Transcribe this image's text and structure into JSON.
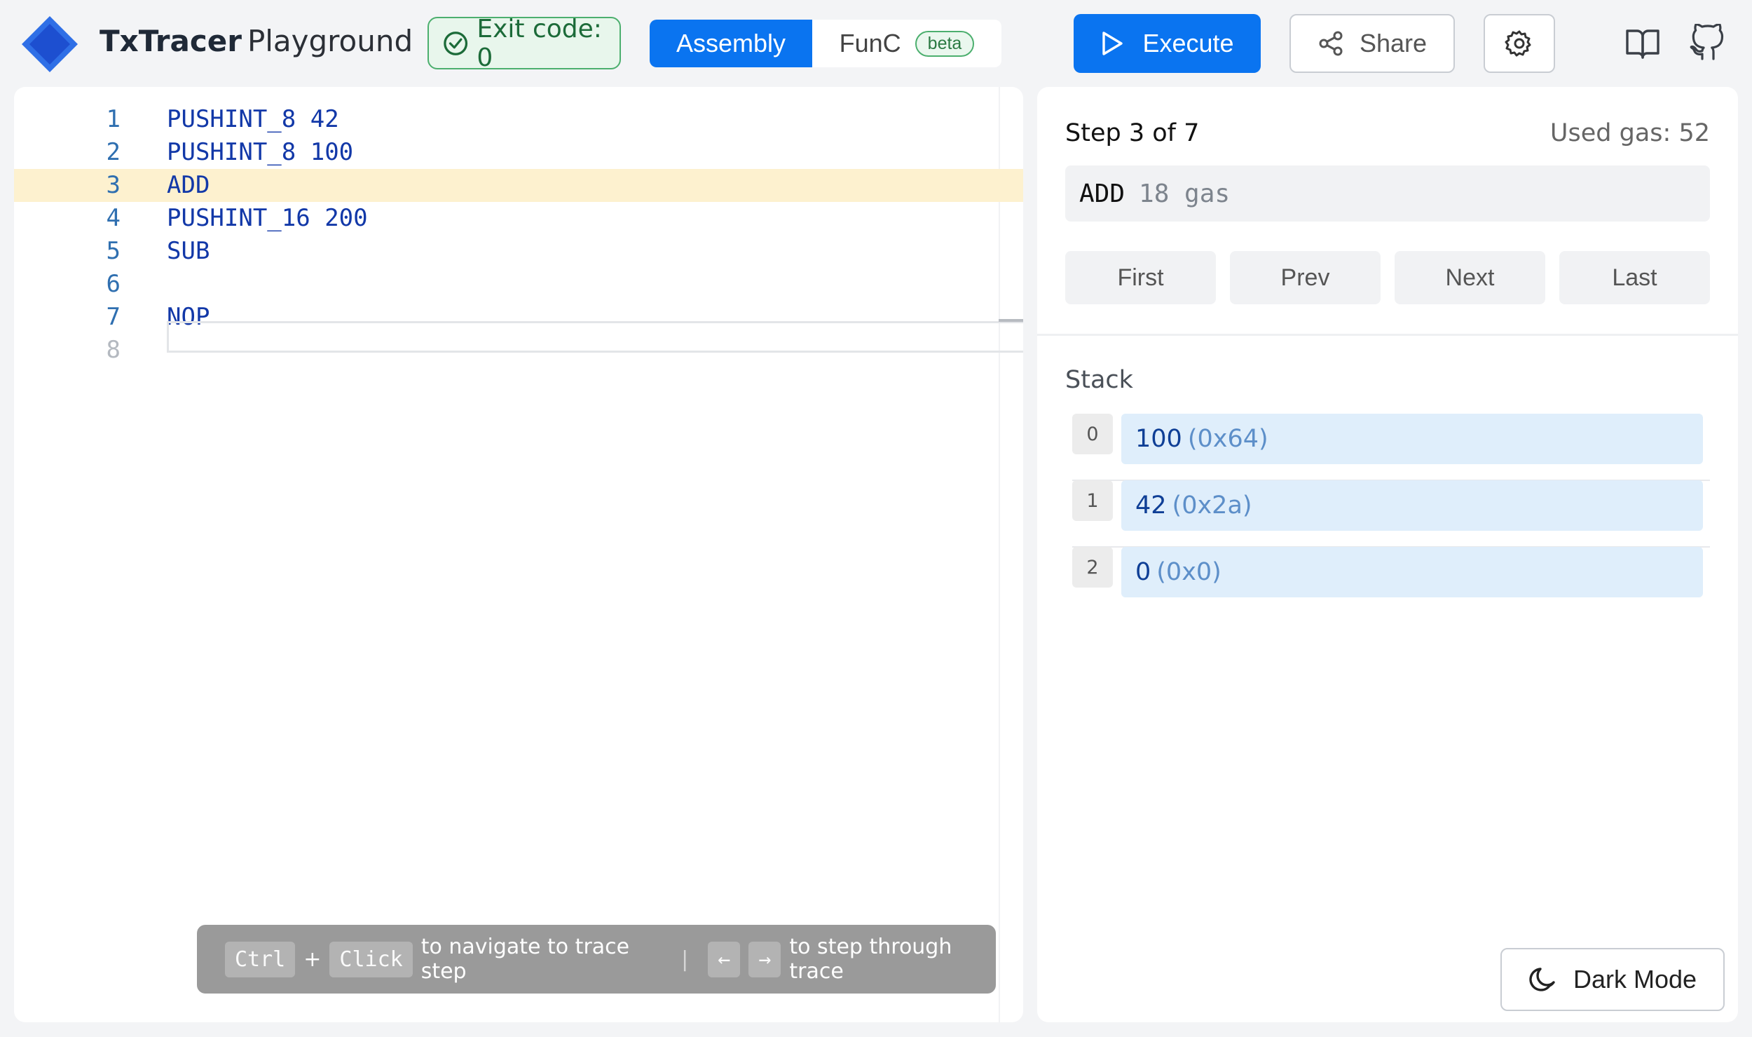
{
  "header": {
    "brand_bold": "TxTracer",
    "brand_light": "Playground",
    "exit_badge": "Exit code: 0",
    "modes": {
      "assembly": "Assembly",
      "func": "FunC",
      "beta": "beta"
    },
    "execute_label": "Execute",
    "share_label": "Share",
    "icons": [
      "logo-icon",
      "check-circle-icon",
      "play-icon",
      "share-icon",
      "gear-icon",
      "book-icon",
      "github-icon"
    ]
  },
  "editor": {
    "active_line": 3,
    "lines": [
      {
        "no": "1",
        "op": "PUSHINT_8",
        "arg": "42"
      },
      {
        "no": "2",
        "op": "PUSHINT_8",
        "arg": "100"
      },
      {
        "no": "3",
        "op": "ADD",
        "arg": ""
      },
      {
        "no": "4",
        "op": "PUSHINT_16",
        "arg": "200"
      },
      {
        "no": "5",
        "op": "SUB",
        "arg": ""
      },
      {
        "no": "6",
        "op": "",
        "arg": ""
      },
      {
        "no": "7",
        "op": "NOP",
        "arg": ""
      },
      {
        "no": "8",
        "op": "",
        "arg": ""
      }
    ],
    "hint": {
      "key_ctrl": "Ctrl",
      "plus": "+",
      "key_click": "Click",
      "text1": "to navigate to trace step",
      "sep": "|",
      "key_left": "←",
      "key_right": "→",
      "text2": "to step through trace"
    }
  },
  "panel": {
    "step_title": "Step 3 of 7",
    "used_gas": "Used gas: 52",
    "instruction": {
      "op": "ADD",
      "gas": "18 gas"
    },
    "nav": {
      "first": "First",
      "prev": "Prev",
      "next": "Next",
      "last": "Last"
    },
    "stack_label": "Stack",
    "stack": [
      {
        "index": "0",
        "dec": "100",
        "hex": "(0x64)"
      },
      {
        "index": "1",
        "dec": "42",
        "hex": "(0x2a)"
      },
      {
        "index": "2",
        "dec": "0",
        "hex": "(0x0)"
      }
    ],
    "dark_mode_label": "Dark Mode"
  },
  "colors": {
    "accent": "#0a74f0",
    "success": "#4caf6e",
    "active_line": "#fdf1cf",
    "stack_cell": "#dfeefb"
  }
}
